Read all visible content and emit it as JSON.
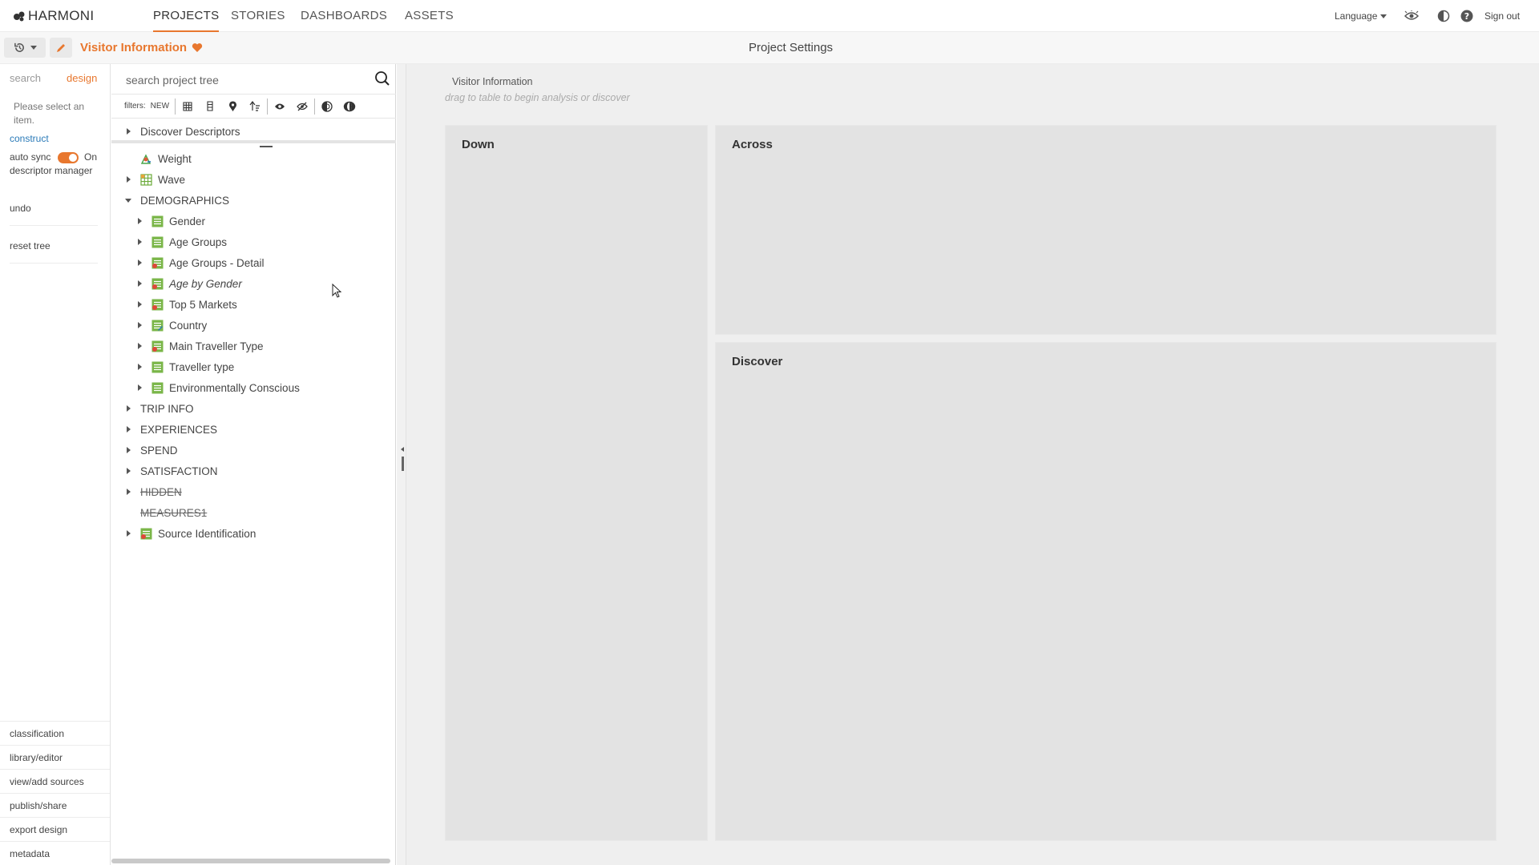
{
  "app": {
    "logo_text": "HARMONI",
    "nav": [
      {
        "label": "PROJECTS",
        "active": true
      },
      {
        "label": "STORIES",
        "active": false
      },
      {
        "label": "DASHBOARDS",
        "active": false
      },
      {
        "label": "ASSETS",
        "active": false
      }
    ],
    "language_label": "Language",
    "signout_label": "Sign out",
    "accent_color": "#e8772e"
  },
  "subbar": {
    "project_title": "Visitor Information",
    "settings_title": "Project Settings"
  },
  "left_panel": {
    "tabs": {
      "search": "search",
      "design": "design"
    },
    "hint": "Please select an item.",
    "construct_link": "construct",
    "auto_sync_label": "auto sync",
    "auto_sync_state": "On",
    "descriptor_manager": "descriptor manager",
    "undo": "undo",
    "reset_tree": "reset tree",
    "bottom_links": [
      "classification",
      "library/editor",
      "view/add sources",
      "publish/share",
      "export design",
      "metadata"
    ]
  },
  "tree": {
    "search_placeholder": "search project tree",
    "filters_label": "filters:",
    "filter_new": "NEW",
    "root": "Discover Descriptors",
    "nodes": [
      {
        "label": "Weight",
        "level": 1,
        "arrow": "none",
        "icon": "weight-icon",
        "style": ""
      },
      {
        "label": "Wave",
        "level": 1,
        "arrow": "right",
        "icon": "grid-icon",
        "style": ""
      },
      {
        "label": "DEMOGRAPHICS",
        "level": 0,
        "arrow": "down",
        "icon": "",
        "style": ""
      },
      {
        "label": "Gender",
        "level": 2,
        "arrow": "right",
        "icon": "list-icon",
        "style": ""
      },
      {
        "label": "Age Groups",
        "level": 2,
        "arrow": "right",
        "icon": "list-icon",
        "style": ""
      },
      {
        "label": "Age Groups - Detail",
        "level": 2,
        "arrow": "right",
        "icon": "list-red-icon",
        "style": ""
      },
      {
        "label": "Age by Gender",
        "level": 2,
        "arrow": "right",
        "icon": "list-red-icon",
        "style": "italic"
      },
      {
        "label": "Top 5 Markets",
        "level": 2,
        "arrow": "right",
        "icon": "list-red-icon",
        "style": ""
      },
      {
        "label": "Country",
        "level": 2,
        "arrow": "right",
        "icon": "list-blue-icon",
        "style": ""
      },
      {
        "label": "Main Traveller Type",
        "level": 2,
        "arrow": "right",
        "icon": "list-red-icon",
        "style": ""
      },
      {
        "label": "Traveller type",
        "level": 2,
        "arrow": "right",
        "icon": "list-icon",
        "style": ""
      },
      {
        "label": "Environmentally Conscious",
        "level": 2,
        "arrow": "right",
        "icon": "list-icon",
        "style": ""
      },
      {
        "label": "TRIP INFO",
        "level": 0,
        "arrow": "right",
        "icon": "",
        "style": ""
      },
      {
        "label": "EXPERIENCES",
        "level": 0,
        "arrow": "right",
        "icon": "",
        "style": ""
      },
      {
        "label": "SPEND",
        "level": 0,
        "arrow": "right",
        "icon": "",
        "style": ""
      },
      {
        "label": "SATISFACTION",
        "level": 0,
        "arrow": "right",
        "icon": "",
        "style": ""
      },
      {
        "label": "HIDDEN",
        "level": 0,
        "arrow": "right",
        "icon": "",
        "style": "strike"
      },
      {
        "label": "MEASURES1",
        "level": 0,
        "arrow": "none",
        "icon": "",
        "style": "strike"
      },
      {
        "label": "Source Identification",
        "level": 1,
        "arrow": "right",
        "icon": "list-red-icon",
        "style": ""
      }
    ]
  },
  "workarea": {
    "title": "Visitor Information",
    "hint": "drag to table to begin analysis or discover",
    "down_label": "Down",
    "across_label": "Across",
    "discover_label": "Discover"
  }
}
